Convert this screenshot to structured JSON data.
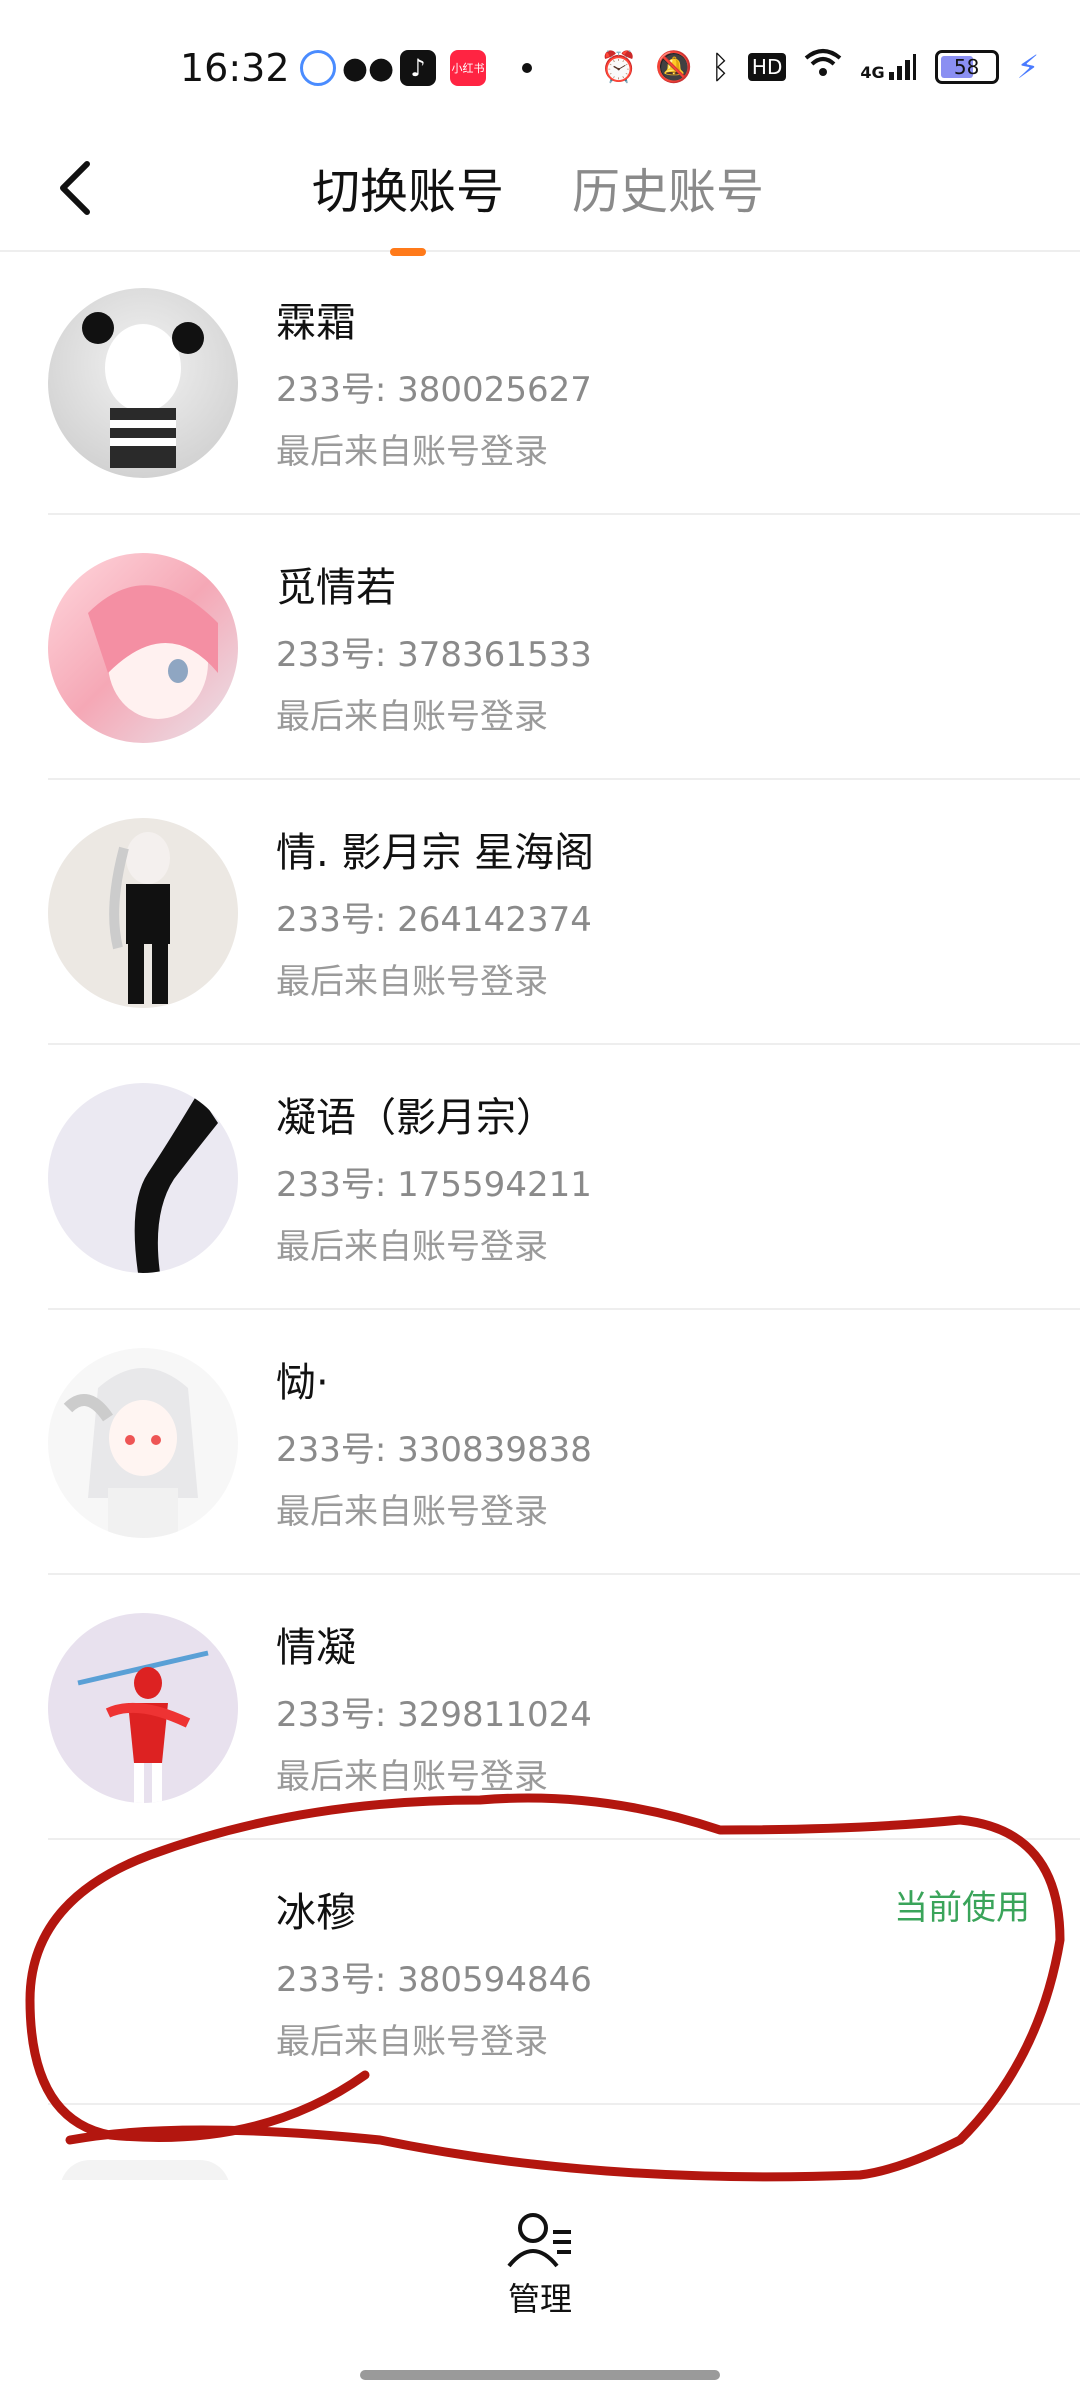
{
  "status_bar": {
    "time": "16:32",
    "apps": [
      "qq-icon",
      "wechat-icon",
      "tiktok-icon",
      "xiaohongshu-icon"
    ],
    "xiaohongshu_label": "小红书",
    "network": "4G",
    "hd": "HD",
    "battery": "58"
  },
  "header": {
    "tabs": [
      {
        "label": "切换账号",
        "active": true
      },
      {
        "label": "历史账号",
        "active": false
      }
    ]
  },
  "accounts": [
    {
      "name": "霖霜",
      "id": "233号: 380025627",
      "source": "最后来自账号登录",
      "current": ""
    },
    {
      "name": "觅情若",
      "id": "233号: 378361533",
      "source": "最后来自账号登录",
      "current": ""
    },
    {
      "name": "情. 影月宗 星海阁",
      "id": "233号: 264142374",
      "source": "最后来自账号登录",
      "current": ""
    },
    {
      "name": "凝语（影月宗）",
      "id": "233号: 175594211",
      "source": "最后来自账号登录",
      "current": ""
    },
    {
      "name": "恸·",
      "id": "233号: 330839838",
      "source": "最后来自账号登录",
      "current": ""
    },
    {
      "name": "情凝",
      "id": "233号: 329811024",
      "source": "最后来自账号登录",
      "current": ""
    },
    {
      "name": "冰穆",
      "id": "233号: 380594846",
      "source": "最后来自账号登录",
      "current": "当前使用"
    }
  ],
  "bottom": {
    "manage_label": "管理"
  },
  "colors": {
    "accent": "#ff7a1a",
    "current_badge": "#3aa45a",
    "annotation": "#b3160f"
  }
}
